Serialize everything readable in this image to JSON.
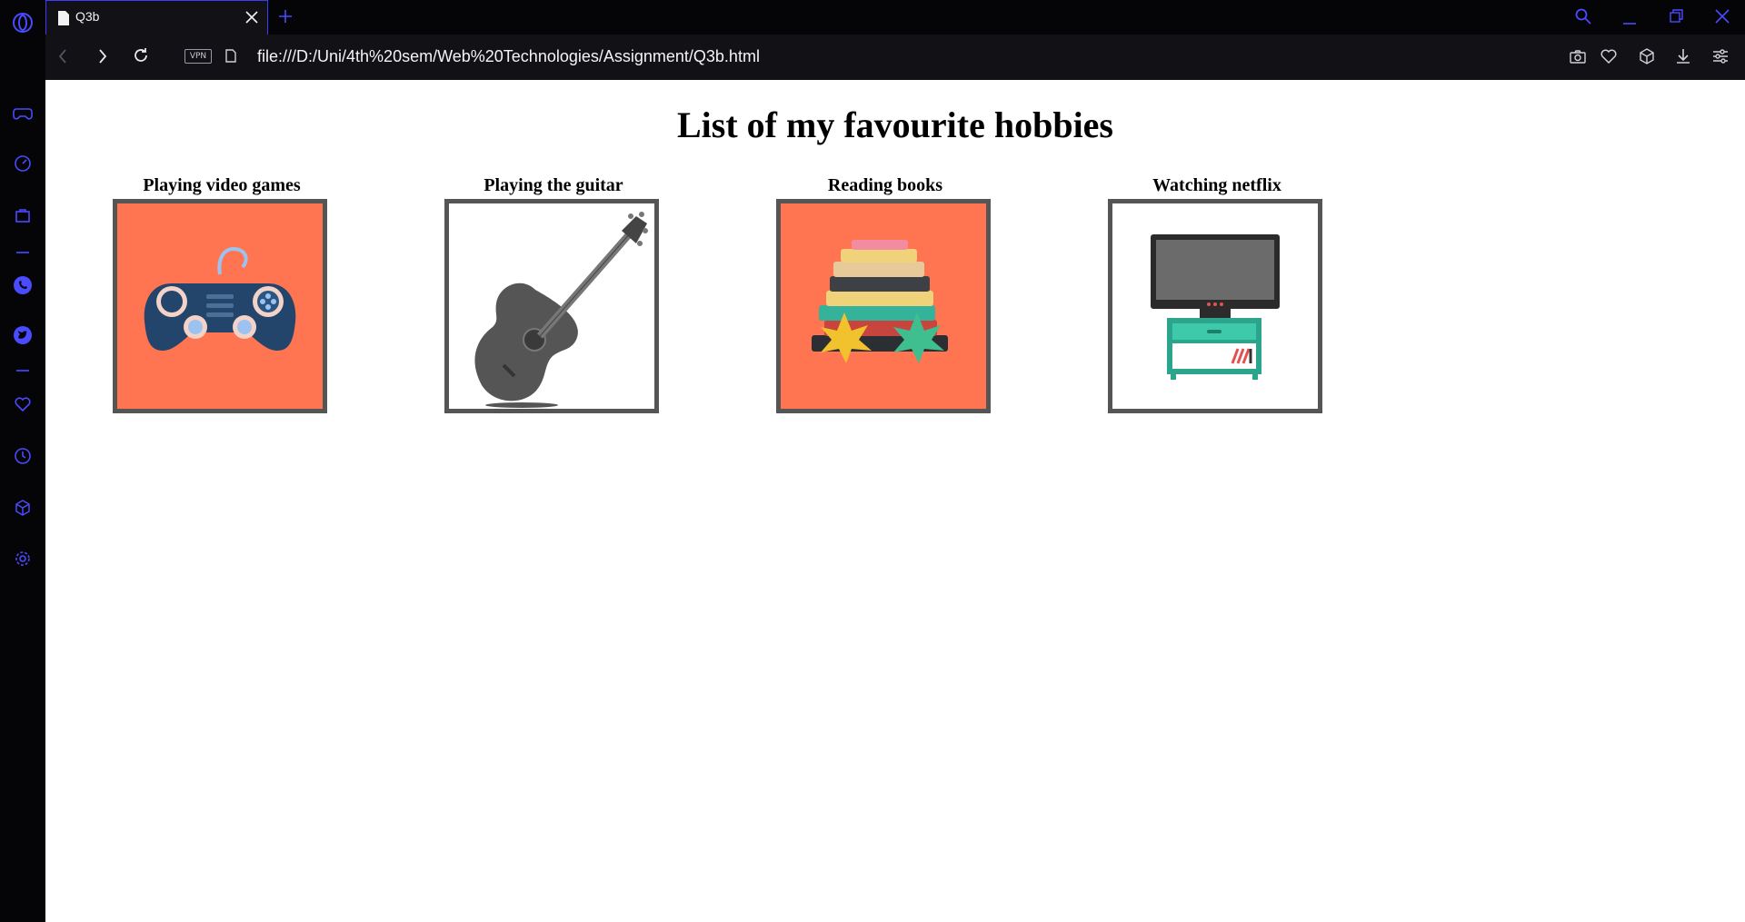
{
  "browser": {
    "tab_title": "Q3b",
    "url": "file:///D:/Uni/4th%20sem/Web%20Technologies/Assignment/Q3b.html",
    "vpn_label": "VPN",
    "accent_color": "#3c3cff"
  },
  "page": {
    "title": "List of my favourite hobbies",
    "hobbies": [
      {
        "label": "Playing video games",
        "icon": "gamepad-icon",
        "background": "#ff7551"
      },
      {
        "label": "Playing the guitar",
        "icon": "guitar-icon",
        "background": "#ffffff"
      },
      {
        "label": "Reading books",
        "icon": "books-icon",
        "background": "#ff7551"
      },
      {
        "label": "Watching netflix",
        "icon": "tv-icon",
        "background": "#ffffff"
      }
    ]
  }
}
